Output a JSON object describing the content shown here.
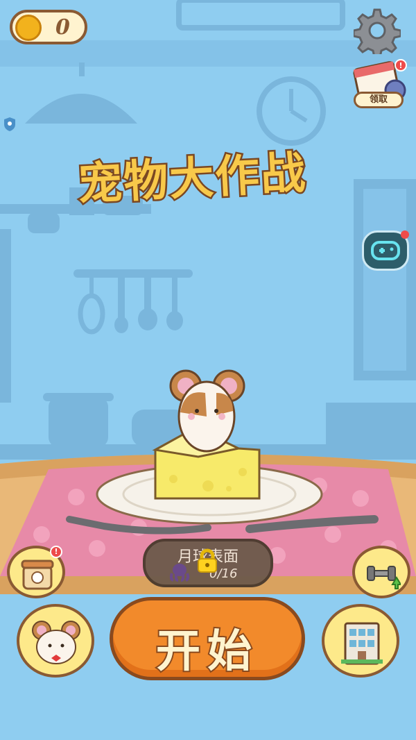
{
  "header": {
    "coin_count": "0"
  },
  "calendar": {
    "claim_label": "领取"
  },
  "title": {
    "text": "宠物大作战"
  },
  "stage": {
    "name": "月球表面",
    "progress": "0/16"
  },
  "actions": {
    "start_label": "开始"
  },
  "icons": [
    "coin-icon",
    "gear-icon",
    "calendar-icon",
    "shield-icon",
    "gamepad-icon",
    "lock-icon",
    "octopus-icon",
    "shop-icon",
    "dumbbell-icon",
    "hamster-icon",
    "building-icon"
  ],
  "colors": {
    "sky": "#8fcdf0",
    "table": "#e9b878",
    "tablecloth": "#e78aa8",
    "start_button": "#f28a2b",
    "cheese": "#f7ea6a"
  }
}
